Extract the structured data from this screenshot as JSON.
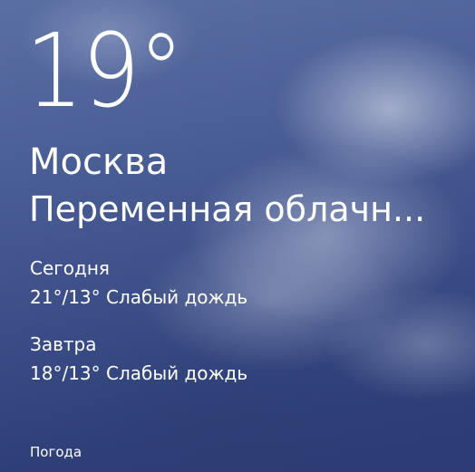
{
  "tile": {
    "temperature": "19°",
    "city": "Москва",
    "condition": "Переменная облачн...",
    "today": {
      "label": "Сегодня",
      "forecast": "21°/13° Слабый дождь"
    },
    "tomorrow": {
      "label": "Завтра",
      "forecast": "18°/13° Слабый дождь"
    },
    "app_name": "Погода"
  },
  "colors": {
    "text": "#ffffff",
    "sky_dark": "#2b3b73",
    "sky_light": "#5a6fa3"
  }
}
